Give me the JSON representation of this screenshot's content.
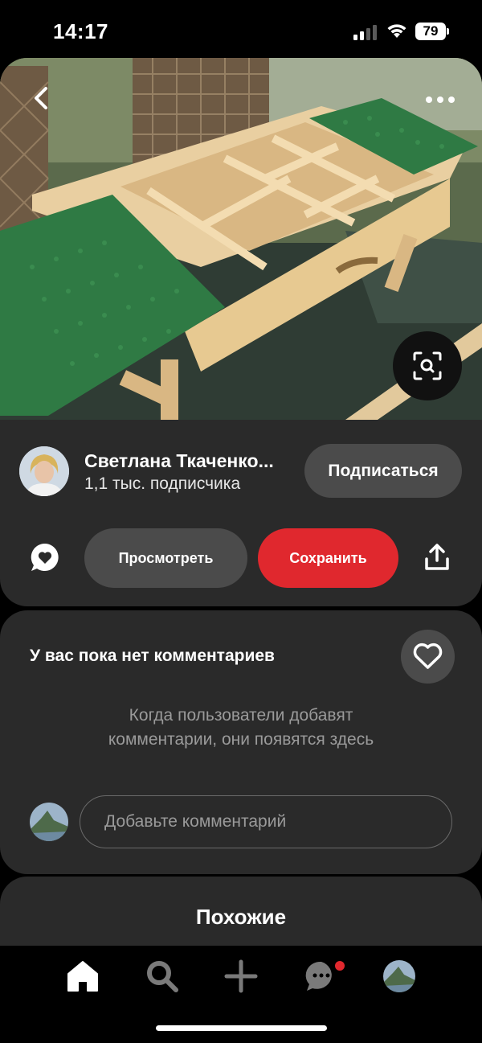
{
  "status_bar": {
    "time": "14:17",
    "battery_level": "79",
    "icons": [
      "cellular-signal-icon",
      "wifi-icon",
      "battery-icon"
    ]
  },
  "pin": {
    "image_description_icon": "photo",
    "creator": {
      "name": "Светлана Ткаченко...",
      "followers": "1,1 тыс. подписчика"
    },
    "subscribe_label": "Подписаться",
    "view_label": "Просмотреть",
    "save_label": "Сохранить",
    "icons": [
      "back-chevron-icon",
      "more-options-icon",
      "visual-search-icon",
      "comment-icon",
      "share-icon"
    ]
  },
  "comments": {
    "title": "У вас пока нет комментариев",
    "empty_text": "Когда пользователи добавят комментарии, они появятся здесь",
    "input_placeholder": "Добавьте комментарий"
  },
  "similar": {
    "title": "Похожие"
  },
  "bottom_nav": {
    "items": [
      "home-icon",
      "search-icon",
      "create-icon",
      "messages-icon",
      "profile-avatar"
    ],
    "has_message_notification": true
  },
  "colors": {
    "background": "#000000",
    "card": "#2a2a2a",
    "button_secondary": "#4b4b4b",
    "accent_red": "#e0282e",
    "muted_text": "#9a9a9a"
  }
}
